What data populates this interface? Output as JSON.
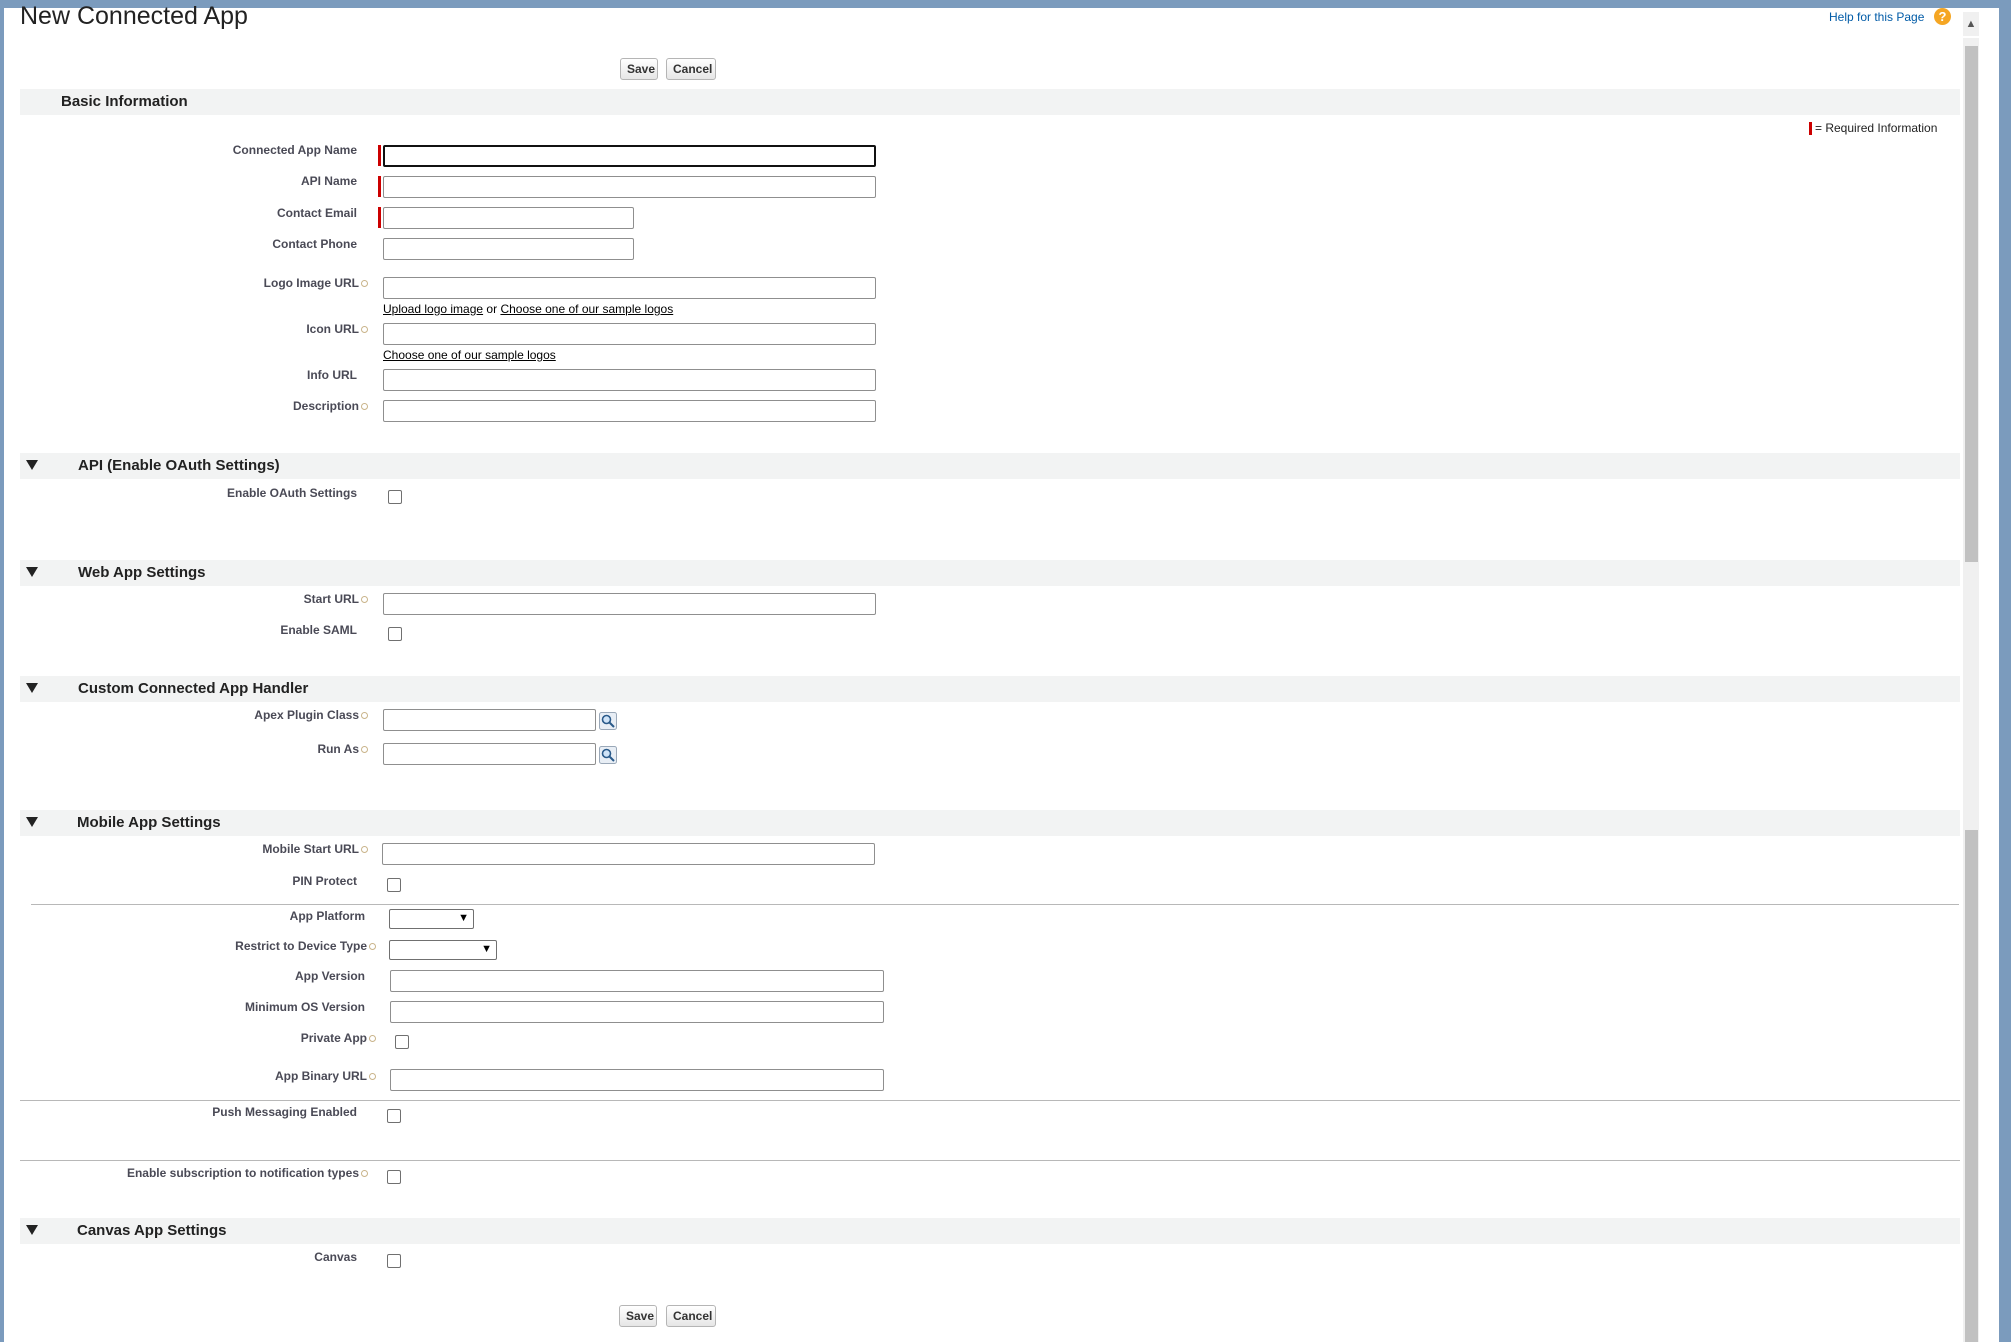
{
  "page": {
    "title": "New Connected App",
    "help_link": "Help for this Page",
    "help_icon": "help-icon",
    "save_label": "Save",
    "cancel_label": "Cancel",
    "required_legend": "= Required Information"
  },
  "sections": {
    "basic": {
      "title": "Basic Information",
      "fields": {
        "app_name": "Connected App Name",
        "api_name": "API Name",
        "contact_email": "Contact Email",
        "contact_phone": "Contact Phone",
        "logo_url": "Logo Image URL",
        "icon_url": "Icon URL",
        "info_url": "Info URL",
        "description": "Description"
      },
      "links": {
        "upload_logo": "Upload logo image",
        "or": "or",
        "sample_logos": "Choose one of our sample logos",
        "sample_logos_icon": "Choose one of our sample logos"
      }
    },
    "api": {
      "title": "API (Enable OAuth Settings)",
      "fields": {
        "enable_oauth": "Enable OAuth Settings"
      }
    },
    "webapp": {
      "title": "Web App Settings",
      "fields": {
        "start_url": "Start URL",
        "enable_saml": "Enable SAML"
      }
    },
    "handler": {
      "title": "Custom Connected App Handler",
      "fields": {
        "apex_plugin": "Apex Plugin Class",
        "run_as": "Run As"
      }
    },
    "mobile": {
      "title": "Mobile App Settings",
      "fields": {
        "mobile_start_url": "Mobile Start URL",
        "pin_protect": "PIN Protect",
        "app_platform": "App Platform",
        "restrict_device": "Restrict to Device Type",
        "app_version": "App Version",
        "min_os": "Minimum OS Version",
        "private_app": "Private App",
        "app_binary_url": "App Binary URL",
        "push_messaging": "Push Messaging Enabled",
        "subscription": "Enable subscription to notification types"
      }
    },
    "canvas": {
      "title": "Canvas App Settings",
      "fields": {
        "canvas": "Canvas"
      }
    }
  },
  "colors": {
    "frame": "#7b9bbd",
    "section_bg": "#f2f3f3",
    "required": "#cc0000",
    "help_icon": "#f5a623"
  }
}
